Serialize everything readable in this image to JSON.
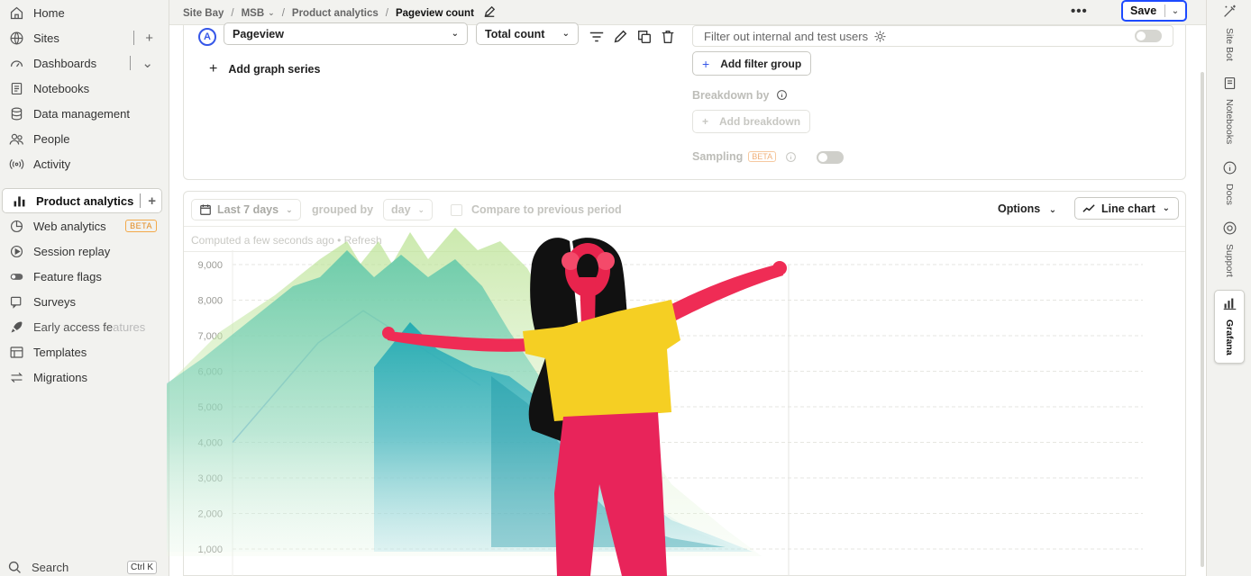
{
  "sidebar": {
    "items": [
      {
        "label": "Home",
        "icon": "home-icon"
      },
      {
        "label": "Sites",
        "icon": "globe-icon",
        "aux": "+"
      },
      {
        "label": "Dashboards",
        "icon": "dashboard-icon",
        "aux": "⌄"
      },
      {
        "label": "Notebooks",
        "icon": "notebook-icon"
      },
      {
        "label": "Data management",
        "icon": "database-icon"
      },
      {
        "label": "People",
        "icon": "people-icon"
      },
      {
        "label": "Activity",
        "icon": "activity-icon"
      },
      {
        "label": "Product analytics",
        "icon": "bar-chart-icon",
        "aux": "+",
        "active": true
      },
      {
        "label": "Web analytics",
        "icon": "web-analytics-icon",
        "badge": "BETA"
      },
      {
        "label": "Session replay",
        "icon": "replay-icon"
      },
      {
        "label": "Feature flags",
        "icon": "toggle-icon"
      },
      {
        "label": "Surveys",
        "icon": "survey-icon"
      },
      {
        "label": "Early access features",
        "icon": "rocket-icon"
      },
      {
        "label": "Templates",
        "icon": "template-icon"
      },
      {
        "label": "Migrations",
        "icon": "migration-icon"
      }
    ],
    "early_access_part1": "Early access fe",
    "early_access_part2": "atures",
    "search_label": "Search",
    "search_shortcut": "Ctrl K"
  },
  "breadcrumbs": {
    "items": [
      "Site Bay",
      "MSB",
      "Product analytics",
      "Pageview count"
    ],
    "separator": "/"
  },
  "topbar": {
    "more_label": "•••",
    "save_label": "Save"
  },
  "right_rail": {
    "items": [
      {
        "label": "Site Bot",
        "icon": "magic-wand-icon"
      },
      {
        "label": "Notebooks",
        "icon": "notebook-icon"
      },
      {
        "label": "Docs",
        "icon": "info-icon"
      },
      {
        "label": "Support",
        "icon": "support-icon"
      },
      {
        "label": "Grafana",
        "icon": "grafana-icon",
        "active": true
      }
    ]
  },
  "query": {
    "series_letter": "A",
    "event_label": "Pageview",
    "math_label": "Total count",
    "add_series_label": "Add graph series",
    "filter_placeholder": "Filter out internal and test users",
    "add_filter_group_label": "Add filter group",
    "breakdown_label": "Breakdown by",
    "add_breakdown_label": "Add breakdown",
    "sampling_label": "Sampling",
    "sampling_badge": "BETA"
  },
  "results": {
    "date_range": "Last 7 days",
    "grouped_by_label": "grouped by",
    "interval": "day",
    "compare_label": "Compare to previous period",
    "options_label": "Options",
    "chart_type_label": "Line chart",
    "computed_text": "Computed a few seconds ago • Refresh"
  },
  "chart_data": {
    "type": "line",
    "title": "",
    "xlabel": "",
    "ylabel": "",
    "ylim": [
      0,
      9000
    ],
    "yticks": [
      "9,000",
      "8,000",
      "7,000",
      "6,000",
      "5,000",
      "4,000",
      "3,000",
      "2,000",
      "1,000"
    ],
    "series": [
      {
        "values": [
          4000,
          6800,
          7700,
          5600
        ]
      }
    ],
    "series_color": "#8fb4e8"
  }
}
